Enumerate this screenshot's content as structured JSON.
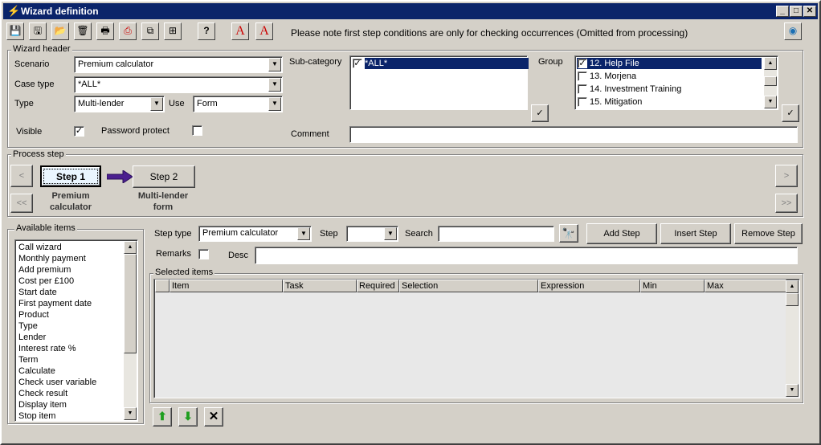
{
  "window": {
    "title": "Wizard definition"
  },
  "toolbar": {
    "note": "Please note first step conditions are only for checking occurrences (Omitted from processing)"
  },
  "wizard_header": {
    "label": "Wizard header",
    "scenario_label": "Scenario",
    "scenario_value": "Premium calculator",
    "case_type_label": "Case type",
    "case_type_value": "*ALL*",
    "type_label": "Type",
    "type_value": "Multi-lender",
    "use_label": "Use",
    "use_value": "Form",
    "visible_label": "Visible",
    "password_label": "Password protect",
    "subcategory_label": "Sub-category",
    "subcategory_items": [
      "*ALL*"
    ],
    "group_label": "Group",
    "group_items": [
      "12. Help File",
      "13. Morjena",
      "14. Investment Training",
      "15. Mitigation"
    ],
    "comment_label": "Comment"
  },
  "process_step": {
    "label": "Process step",
    "nav_prev": "<",
    "nav_first": "<<",
    "nav_next": ">",
    "nav_last": ">>",
    "step1_label": "Step 1",
    "step1_caption1": "Premium",
    "step1_caption2": "calculator",
    "step2_label": "Step 2",
    "step2_caption1": "Multi-lender",
    "step2_caption2": "form"
  },
  "available": {
    "label": "Available items",
    "items": [
      "Call wizard",
      "Monthly payment",
      "Add premium",
      "Cost per £100",
      "Start date",
      "First payment date",
      "Product",
      "Type",
      "Lender",
      "Interest rate %",
      "Term",
      "Calculate",
      "Check user variable",
      "Check result",
      "Display item",
      "Stop item"
    ]
  },
  "step_controls": {
    "step_type_label": "Step type",
    "step_type_value": "Premium calculator",
    "step_label": "Step",
    "step_value": "",
    "search_label": "Search",
    "search_value": "",
    "add_step": "Add Step",
    "insert_step": "Insert Step",
    "remove_step": "Remove Step",
    "remarks_label": "Remarks",
    "desc_label": "Desc"
  },
  "selected": {
    "label": "Selected items",
    "columns": [
      "Item",
      "Task",
      "Required",
      "Selection",
      "Expression",
      "Min",
      "Max"
    ]
  }
}
